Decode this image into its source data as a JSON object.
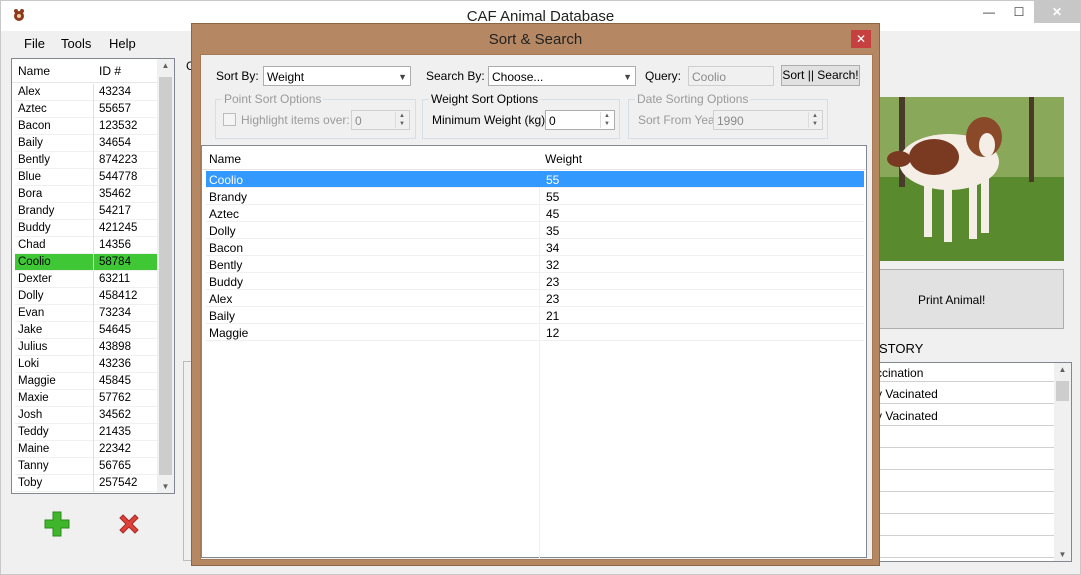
{
  "window": {
    "title": "CAF Animal Database",
    "min": "—",
    "max": "☐",
    "close": "✕"
  },
  "menu": [
    {
      "label": "File"
    },
    {
      "label": "Tools"
    },
    {
      "label": "Help"
    }
  ],
  "animal_list": {
    "headers": {
      "name": "Name",
      "id": "ID #"
    },
    "rows": [
      {
        "name": "Alex",
        "id": "43234"
      },
      {
        "name": "Aztec",
        "id": "55657"
      },
      {
        "name": "Bacon",
        "id": "123532"
      },
      {
        "name": "Baily",
        "id": "34654"
      },
      {
        "name": "Bently",
        "id": "874223"
      },
      {
        "name": "Blue",
        "id": "544778"
      },
      {
        "name": "Bora",
        "id": "35462"
      },
      {
        "name": "Brandy",
        "id": "54217"
      },
      {
        "name": "Buddy",
        "id": "421245"
      },
      {
        "name": "Chad",
        "id": "14356"
      },
      {
        "name": "Coolio",
        "id": "58784"
      },
      {
        "name": "Dexter",
        "id": "63211"
      },
      {
        "name": "Dolly",
        "id": "458412"
      },
      {
        "name": "Evan",
        "id": "73234"
      },
      {
        "name": "Jake",
        "id": "54645"
      },
      {
        "name": "Julius",
        "id": "43898"
      },
      {
        "name": "Loki",
        "id": "43236"
      },
      {
        "name": "Maggie",
        "id": "45845"
      },
      {
        "name": "Maxie",
        "id": "57762"
      },
      {
        "name": "Josh",
        "id": "34562"
      },
      {
        "name": "Teddy",
        "id": "21435"
      },
      {
        "name": "Maine",
        "id": "22342"
      },
      {
        "name": "Tanny",
        "id": "56765"
      },
      {
        "name": "Toby",
        "id": "257542"
      }
    ],
    "selected": "Coolio"
  },
  "background": {
    "group_label": "G",
    "print_button": "Print Animal!",
    "history_label": "STORY",
    "history_rows": [
      "ccination",
      "y Vacinated",
      "y Vacinated"
    ]
  },
  "dialog": {
    "title": "Sort & Search",
    "close": "✕",
    "sort_by_label": "Sort By:",
    "sort_by_value": "Weight",
    "search_by_label": "Search By:",
    "search_by_value": "Choose...",
    "query_label": "Query:",
    "query_value": "Coolio",
    "sort_search_button": "Sort || Search!",
    "point_group": {
      "title": "Point Sort Options",
      "checkbox_label": "Highlight items over:",
      "value": "0"
    },
    "weight_group": {
      "title": "Weight Sort Options",
      "label": "Minimum Weight (kg):",
      "value": "0"
    },
    "date_group": {
      "title": "Date Sorting Options",
      "label": "Sort From Year:",
      "value": "1990"
    },
    "results": {
      "headers": {
        "name": "Name",
        "weight": "Weight"
      },
      "rows": [
        {
          "name": "Coolio",
          "weight": "55"
        },
        {
          "name": "Brandy",
          "weight": "55"
        },
        {
          "name": "Aztec",
          "weight": "45"
        },
        {
          "name": "Dolly",
          "weight": "35"
        },
        {
          "name": "Bacon",
          "weight": "34"
        },
        {
          "name": "Bently",
          "weight": "32"
        },
        {
          "name": "Buddy",
          "weight": "23"
        },
        {
          "name": "Alex",
          "weight": "23"
        },
        {
          "name": "Baily",
          "weight": "21"
        },
        {
          "name": "Maggie",
          "weight": "12"
        }
      ],
      "selected": "Coolio"
    }
  },
  "colors": {
    "selected_list_row": "#3fc736",
    "selected_result_row": "#3399ff",
    "dialog_frame": "#b58863"
  }
}
